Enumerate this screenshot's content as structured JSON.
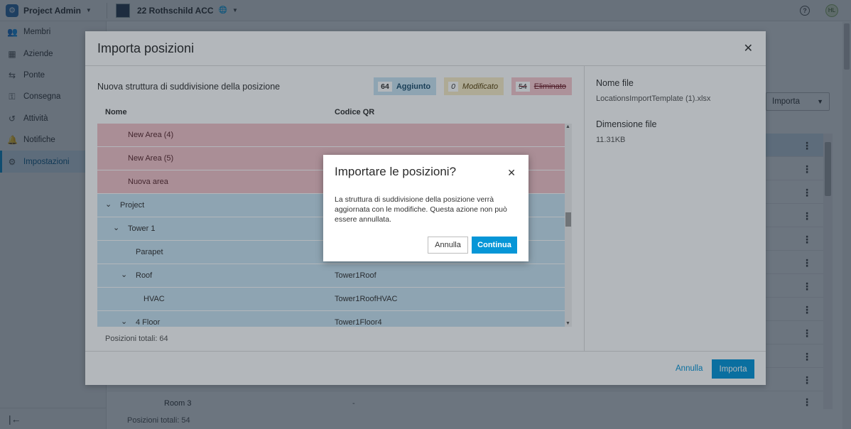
{
  "topbar": {
    "app_title": "Project Admin",
    "project_name": "22 Rothschild ACC",
    "avatar_initials": "HL"
  },
  "sidebar": {
    "items": [
      {
        "label": "Membri",
        "icon": "people-icon"
      },
      {
        "label": "Aziende",
        "icon": "building-icon"
      },
      {
        "label": "Ponte",
        "icon": "bridge-icon"
      },
      {
        "label": "Consegna",
        "icon": "key-icon"
      },
      {
        "label": "Attività",
        "icon": "history-icon"
      },
      {
        "label": "Notifiche",
        "icon": "bell-icon"
      },
      {
        "label": "Impostazioni",
        "icon": "gear-icon",
        "active": true
      }
    ]
  },
  "background": {
    "import_button": "Importa",
    "room_label": "Room 3",
    "room_qr": "-",
    "total": "Posizioni totali: 54"
  },
  "import_modal": {
    "title": "Importa posizioni",
    "subtitle": "Nuova struttura di suddivisione della posizione",
    "chips": {
      "added": {
        "count": "64",
        "label": "Aggiunto"
      },
      "modified": {
        "count": "0",
        "label": "Modificato"
      },
      "deleted": {
        "count": "54",
        "label": "Eliminato"
      }
    },
    "columns": {
      "name": "Nome",
      "qr": "Codice QR"
    },
    "rows": [
      {
        "name": "New Area (4)",
        "qr": "",
        "status": "deleted"
      },
      {
        "name": "New Area (5)",
        "qr": "",
        "status": "deleted"
      },
      {
        "name": "Nuova area",
        "qr": "",
        "status": "deleted"
      },
      {
        "name": "Project",
        "qr": "",
        "status": "added"
      },
      {
        "name": "Tower 1",
        "qr": "",
        "status": "added"
      },
      {
        "name": "Parapet",
        "qr": "",
        "status": "added"
      },
      {
        "name": "Roof",
        "qr": "Tower1Roof",
        "status": "added"
      },
      {
        "name": "HVAC",
        "qr": "Tower1RoofHVAC",
        "status": "added"
      },
      {
        "name": "4 Floor",
        "qr": "Tower1Floor4",
        "status": "added"
      }
    ],
    "total": "Posizioni totali: 64",
    "file_name_label": "Nome file",
    "file_name": "LocationsImportTemplate (1).xlsx",
    "file_size_label": "Dimensione file",
    "file_size": "11.31KB",
    "cancel": "Annulla",
    "import": "Importa"
  },
  "confirm": {
    "title": "Importare le posizioni?",
    "body": "La struttura di suddivisione della posizione verrà aggiornata con le modifiche. Questa azione non può essere annullata.",
    "cancel": "Annulla",
    "continue": "Continua"
  }
}
